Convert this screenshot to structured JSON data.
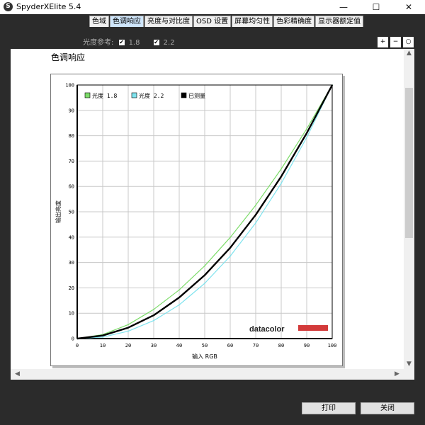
{
  "window": {
    "app_icon": "S",
    "title": "SpyderXElite 5.4",
    "minimize": "—",
    "maximize": "☐",
    "close": "✕"
  },
  "tabs": [
    {
      "label": "色域"
    },
    {
      "label": "色调响应",
      "active": true
    },
    {
      "label": "亮度与对比度"
    },
    {
      "label": "OSD 设置"
    },
    {
      "label": "屏幕均匀性"
    },
    {
      "label": "色彩精确度"
    },
    {
      "label": "显示器额定值"
    }
  ],
  "options": {
    "label": "光度参考:",
    "check1": "✔",
    "opt1": "1.8",
    "check2": "✔",
    "opt2": "2.2"
  },
  "zoom": {
    "zoom_in": "+",
    "zoom_out": "−",
    "zoom_fit": "○"
  },
  "section_title": "色调响应",
  "brand": "datacolor",
  "colors": {
    "gamma18": "#7ddc6a",
    "gamma22": "#7fe3ee",
    "measured": "#000000",
    "brand_red": "#d33a3a"
  },
  "scroll": {
    "up": "▲",
    "down": "▼",
    "left": "◀",
    "right": "▶"
  },
  "buttons": {
    "print": "打印",
    "close": "关闭"
  },
  "chart_data": {
    "type": "line",
    "xlabel": "输入 RGB",
    "ylabel": "输出亮度",
    "xlim": [
      0,
      100
    ],
    "ylim": [
      0,
      100
    ],
    "xticks": [
      0,
      10,
      20,
      30,
      40,
      50,
      60,
      70,
      80,
      90,
      100
    ],
    "yticks": [
      0,
      10,
      20,
      30,
      40,
      50,
      60,
      70,
      80,
      90,
      100
    ],
    "grid": true,
    "legend_position": "top-left",
    "x": [
      0,
      10,
      20,
      30,
      40,
      50,
      60,
      70,
      80,
      90,
      100
    ],
    "series": [
      {
        "name": "光度 1.8",
        "color": "#7ddc6a",
        "values": [
          0,
          1.6,
          5.5,
          11.5,
          19.2,
          28.7,
          39.9,
          52.6,
          66.9,
          82.7,
          100
        ]
      },
      {
        "name": "光度 2.2",
        "color": "#7fe3ee",
        "values": [
          0,
          0.6,
          2.9,
          7.1,
          13.3,
          21.8,
          32.5,
          45.6,
          61.2,
          79.3,
          100
        ]
      },
      {
        "name": "已测量",
        "color": "#000000",
        "values": [
          0,
          1.2,
          4.3,
          9.2,
          16.2,
          25.0,
          35.8,
          48.8,
          63.9,
          81.0,
          100
        ]
      }
    ]
  }
}
